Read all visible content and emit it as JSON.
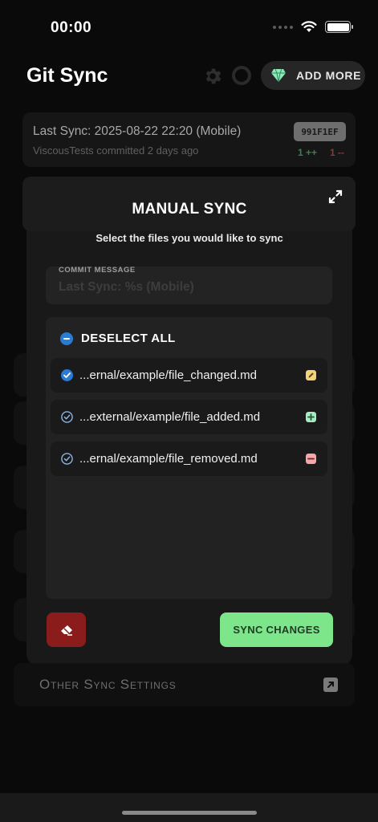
{
  "status_bar": {
    "time": "00:00"
  },
  "header": {
    "title": "Git Sync",
    "add_more_label": "ADD MORE",
    "icons": [
      "gear-icon",
      "ring-icon",
      "diamond-icon"
    ]
  },
  "last_sync": {
    "title": "Last Sync: 2025-08-22 22:20 (Mobile)",
    "subtitle": "ViscousTests committed 2 days ago",
    "hash": "991F1EF",
    "added": "1 ++",
    "removed": "1 --"
  },
  "modal": {
    "title": "MANUAL SYNC",
    "subtitle": "Select the files you would like to sync",
    "commit_label": "COMMIT MESSAGE",
    "commit_placeholder": "Last Sync: %s (Mobile)",
    "deselect_label": "DESELECT ALL",
    "files": [
      {
        "name": "...ernal/example/file_changed.md",
        "status": "changed",
        "selected": true
      },
      {
        "name": "...external/example/file_added.md",
        "status": "added",
        "selected": false
      },
      {
        "name": "...ernal/example/file_removed.md",
        "status": "removed",
        "selected": false
      }
    ],
    "sync_label": "SYNC CHANGES"
  },
  "other_settings_label": "Other Sync Settings",
  "colors": {
    "accent_blue": "#2a7bd6",
    "sync_green": "#7de58a",
    "discard_red": "#8b1c1c",
    "changed_tag": "#f3d37a",
    "added_tag": "#a6ecc0",
    "removed_tag": "#f4a7a9"
  }
}
